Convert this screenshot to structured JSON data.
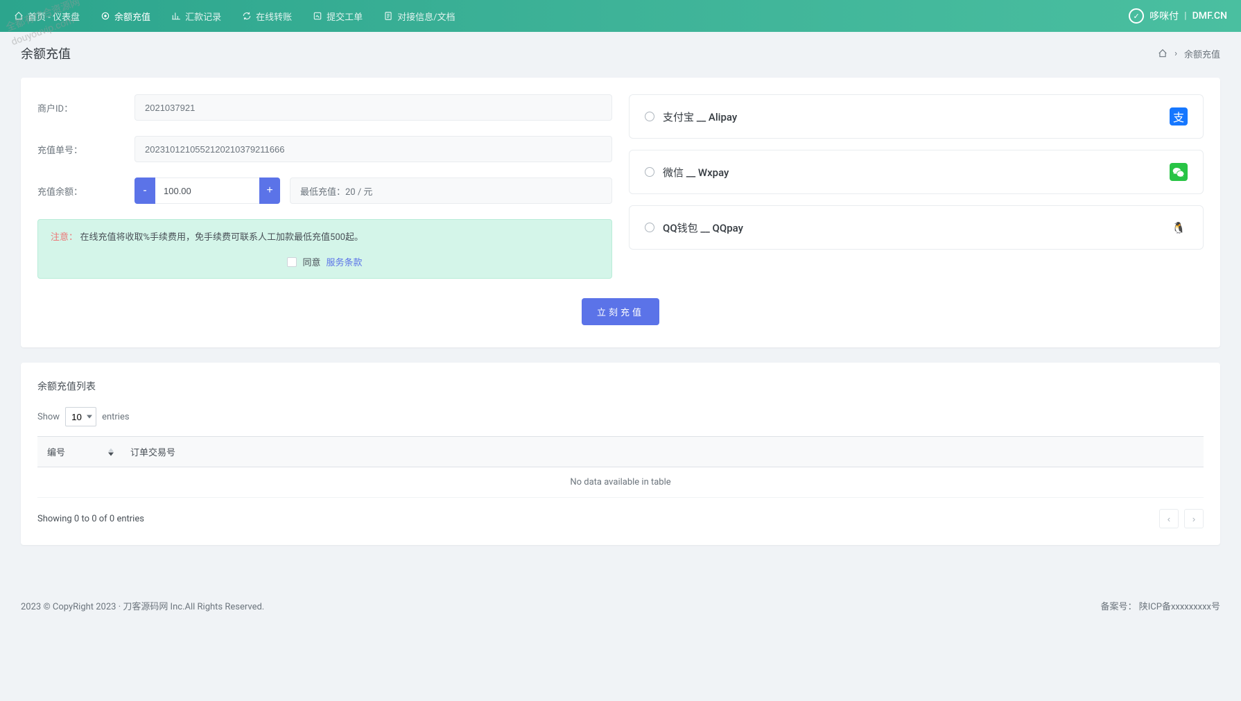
{
  "nav": {
    "items": [
      {
        "label": "首页 - 仪表盘",
        "active": false
      },
      {
        "label": "余额充值",
        "active": true
      },
      {
        "label": "汇款记录",
        "active": false
      },
      {
        "label": "在线转账",
        "active": false
      },
      {
        "label": "提交工单",
        "active": false
      },
      {
        "label": "对接信息/文档",
        "active": false
      }
    ]
  },
  "brand": {
    "name": "哆咪付",
    "domain": "DMF.CN"
  },
  "page": {
    "title": "余额充值",
    "breadcrumb_sep": "›",
    "breadcrumb_current": "余额充值"
  },
  "form": {
    "merchant_label": "商户ID：",
    "merchant_value": "2021037921",
    "order_label": "充值单号：",
    "order_value": "2023101210552120210379211666",
    "amount_label": "充值余额：",
    "amount_value": "100.00",
    "minus": "-",
    "plus": "+",
    "min_recharge": "最低充值：20 / 元"
  },
  "alert": {
    "prefix": "注意：",
    "body": "在线充值将收取%手续费用，免手续费可联系人工加款最低充值500起。"
  },
  "agree": {
    "prefix": "同意 ",
    "link": "服务条款"
  },
  "payments": [
    {
      "label": "支付宝 __ Alipay",
      "icon_class": "alipay",
      "icon_char": "支"
    },
    {
      "label": "微信 __ Wxpay",
      "icon_class": "wxpay",
      "icon_char": "●"
    },
    {
      "label": "QQ钱包 __ QQpay",
      "icon_class": "qqpay",
      "icon_char": "🐧"
    }
  ],
  "submit_label": "立刻充值",
  "list": {
    "title": "余额充值列表",
    "show": "Show",
    "entries": "entries",
    "per_page_value": "10",
    "columns": [
      "编号",
      "订单交易号"
    ],
    "empty": "No data available in table",
    "info": "Showing 0 to 0 of 0 entries",
    "prev": "‹",
    "next": "›"
  },
  "footer": {
    "copyright": "2023 © CopyRight 2023 · 刀客源码网 Inc.All Rights Reserved.",
    "icp_label": "备案号：",
    "icp_value": "陕ICP备xxxxxxxxx号"
  },
  "watermark": {
    "line1": "全都有综合资源网",
    "line2": "douyouvip.com"
  }
}
